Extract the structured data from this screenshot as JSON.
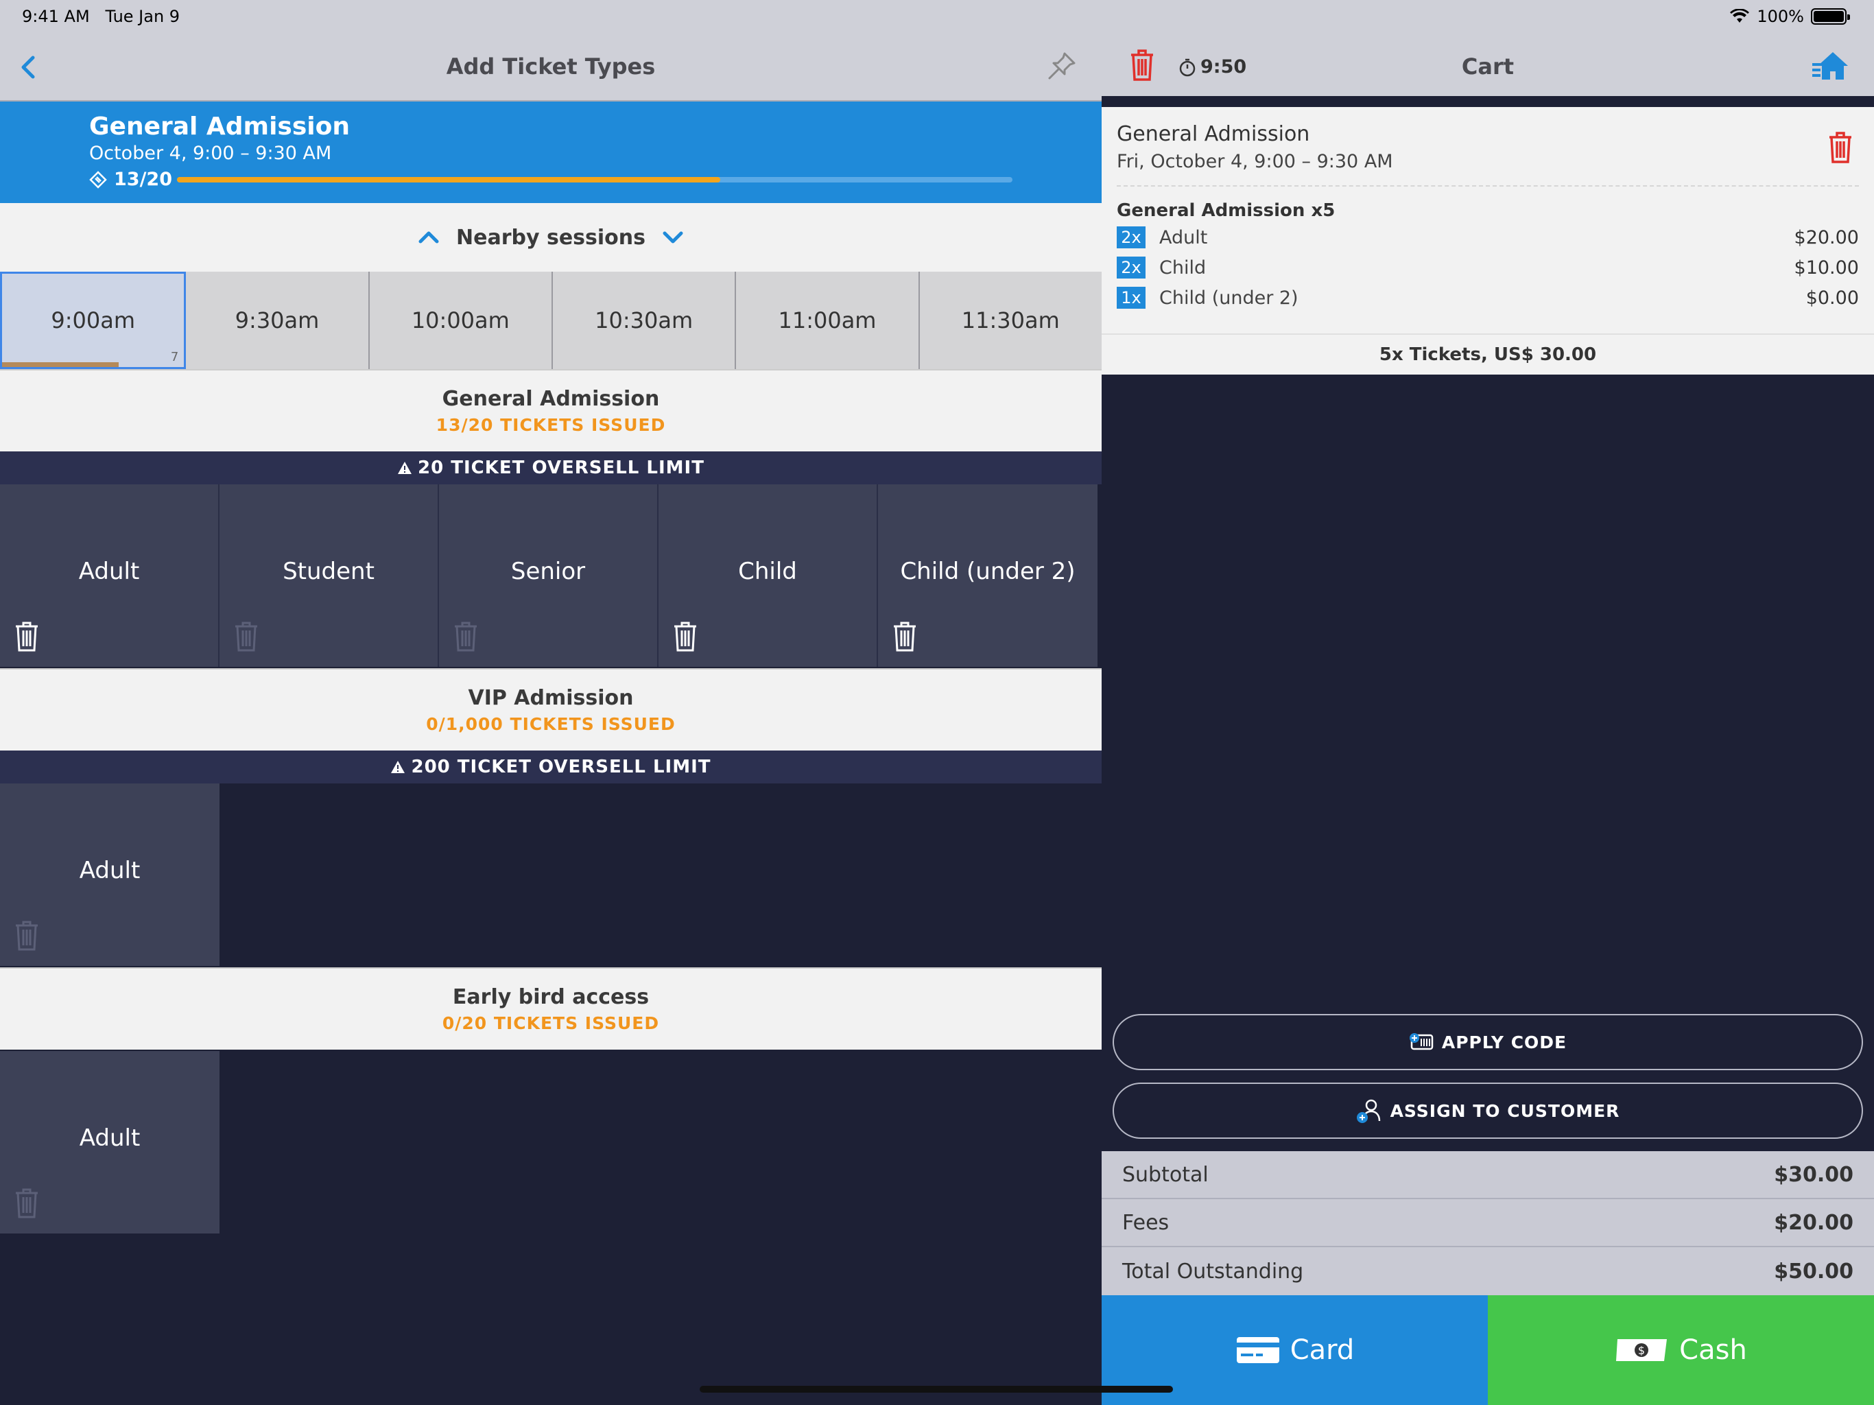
{
  "status": {
    "time": "9:41 AM",
    "date": "Tue Jan 9",
    "battery": "100%"
  },
  "left": {
    "title": "Add Ticket Types",
    "banner": {
      "name": "General Admission",
      "date": "October 4, 9:00 – 9:30 AM",
      "count": "13/20",
      "progress": 0.65
    },
    "nearby_label": "Nearby sessions",
    "times": [
      {
        "label": "9:00am",
        "count": "7",
        "selected": true
      },
      {
        "label": "9:30am"
      },
      {
        "label": "10:00am"
      },
      {
        "label": "10:30am"
      },
      {
        "label": "11:00am"
      },
      {
        "label": "11:30am"
      }
    ],
    "sections": [
      {
        "title": "General Admission",
        "issued": "13/20 TICKETS ISSUED",
        "oversell": "20 TICKET OVERSELL LIMIT",
        "tickets": [
          "Adult",
          "Student",
          "Senior",
          "Child",
          "Child (under 2)"
        ]
      },
      {
        "title": "VIP Admission",
        "issued": "0/1,000 TICKETS ISSUED",
        "oversell": "200 TICKET OVERSELL LIMIT",
        "tickets": [
          "Adult"
        ]
      },
      {
        "title": "Early bird access",
        "issued": "0/20 TICKETS ISSUED",
        "tickets": [
          "Adult"
        ]
      }
    ]
  },
  "cart": {
    "timer": "9:50",
    "title": "Cart",
    "event": "General Admission",
    "date": "Fri, October 4, 9:00 – 9:30 AM",
    "group": "General Admission x5",
    "lines": [
      {
        "qty": "2x",
        "name": "Adult",
        "price": "$20.00"
      },
      {
        "qty": "2x",
        "name": "Child",
        "price": "$10.00"
      },
      {
        "qty": "1x",
        "name": "Child (under 2)",
        "price": "$0.00"
      }
    ],
    "summary": "5x Tickets, US$ 30.00",
    "apply_code": "APPLY CODE",
    "assign_customer": "ASSIGN TO CUSTOMER",
    "subtotal_label": "Subtotal",
    "subtotal": "$30.00",
    "fees_label": "Fees",
    "fees": "$20.00",
    "total_label": "Total Outstanding",
    "total": "$50.00",
    "card_label": "Card",
    "cash_label": "Cash"
  },
  "colors": {
    "accent": "#1f8ad9",
    "orange": "#f2951d",
    "green": "#45c64b",
    "danger": "#e0302b",
    "navy": "#1d2035"
  }
}
